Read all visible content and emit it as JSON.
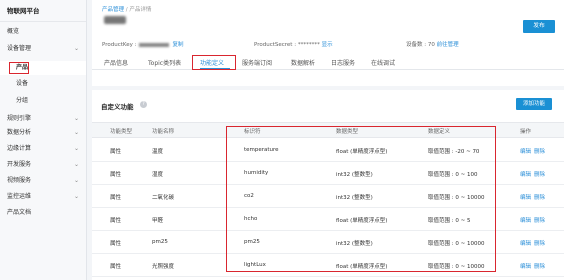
{
  "sidebar": {
    "brand": "物联网平台",
    "items": [
      {
        "label": "概览",
        "chevron": false
      },
      {
        "label": "设备管理",
        "chevron": true
      },
      {
        "label": "产品",
        "chevron": false
      },
      {
        "label": "设备",
        "chevron": false
      },
      {
        "label": "分组",
        "chevron": false
      },
      {
        "label": "规则引擎",
        "chevron": true
      },
      {
        "label": "数据分析",
        "chevron": true
      },
      {
        "label": "边缘计算",
        "chevron": true
      },
      {
        "label": "开发服务",
        "chevron": true
      },
      {
        "label": "视频服务",
        "chevron": true
      },
      {
        "label": "监控运维",
        "chevron": true
      },
      {
        "label": "产品文档",
        "chevron": false
      }
    ],
    "chevron_glyph": "⌄"
  },
  "header": {
    "breadcrumb_link": "产品管理",
    "breadcrumb_sep": " / ",
    "breadcrumb_current": "产品详情",
    "publish_label": "发布",
    "product_key_label": "ProductKey :",
    "copy_label": "复制",
    "product_secret_label": "ProductSecret :",
    "secret_masked": "********",
    "show_label": "显示",
    "device_count_label": "设备数 :",
    "device_count": "70",
    "goto_manage_label": "前往管理"
  },
  "tabs": [
    "产品信息",
    "Topic类列表",
    "功能定义",
    "服务端订阅",
    "数据解析",
    "日志服务",
    "在线调试"
  ],
  "section": {
    "title": "自定义功能",
    "help_icon": "?",
    "add_label": "添加功能"
  },
  "table": {
    "headers": [
      "功能类型",
      "功能名称",
      "标识符",
      "数据类型",
      "数据定义",
      "操作"
    ],
    "rows": [
      {
        "type": "属性",
        "name": "温度",
        "id": "temperature",
        "dtype": "float (单精度浮点型)",
        "def": "取值范围 : -20 ~ 70"
      },
      {
        "type": "属性",
        "name": "湿度",
        "id": "humidity",
        "dtype": "int32 (整数型)",
        "def": "取值范围 : 0 ~ 100"
      },
      {
        "type": "属性",
        "name": "二氧化碳",
        "id": "co2",
        "dtype": "int32 (整数型)",
        "def": "取值范围 : 0 ~ 10000"
      },
      {
        "type": "属性",
        "name": "甲醛",
        "id": "hcho",
        "dtype": "float (单精度浮点型)",
        "def": "取值范围 : 0 ~ 5"
      },
      {
        "type": "属性",
        "name": "pm25",
        "id": "pm25",
        "dtype": "int32 (整数型)",
        "def": "取值范围 : 0 ~ 10000"
      },
      {
        "type": "属性",
        "name": "光照强度",
        "id": "lightLux",
        "dtype": "float (单精度浮点型)",
        "def": "取值范围 : 0 ~ 10000"
      }
    ],
    "edit_label": "编辑",
    "delete_label": "删除"
  },
  "colors": {
    "accent": "#1a90d4",
    "highlight": "#d9262f"
  }
}
